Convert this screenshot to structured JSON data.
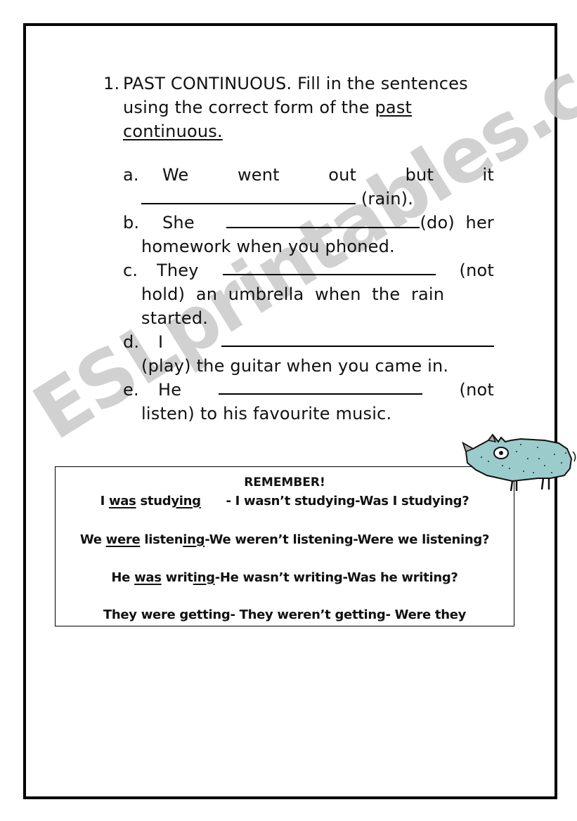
{
  "exercise": {
    "number": "1.",
    "title_plain": "PAST CONTINUOUS. Fill in the sentences using the correct form of the ",
    "title_underlined": "past continuous.",
    "items": [
      {
        "letter": "a.",
        "first": [
          "We",
          "went",
          "out",
          "but",
          "it"
        ],
        "after_blank": "(rain)."
      },
      {
        "letter": "b.",
        "lead": "She",
        "after_blank": "(do)  her",
        "cont": "homework when you phoned."
      },
      {
        "letter": "c.",
        "lead": "They",
        "after_blank": "(not",
        "cont1": "hold)  an  umbrella  when  the  rain",
        "cont2": "started."
      },
      {
        "letter": "d.",
        "lead": "I",
        "cont": "(play) the guitar when you came in."
      },
      {
        "letter": "e.",
        "lead": "He",
        "after_blank": "(not",
        "cont": "listen) to his favourite music."
      }
    ]
  },
  "remember": {
    "title": "REMEMBER!",
    "lines": [
      {
        "parts": [
          {
            "t": "I "
          },
          {
            "t": "was",
            "u": true
          },
          {
            "t": " stud"
          },
          {
            "t": "ying",
            "u": true
          },
          {
            "t": "      - I wasn’t studying-Was I studying?"
          }
        ]
      },
      {
        "parts": [
          {
            "t": "We "
          },
          {
            "t": "were",
            "u": true
          },
          {
            "t": " listen"
          },
          {
            "t": "ing",
            "u": true
          },
          {
            "t": "-We weren’t listening-Were we listening?"
          }
        ]
      },
      {
        "parts": [
          {
            "t": "He "
          },
          {
            "t": "was",
            "u": true
          },
          {
            "t": " writ"
          },
          {
            "t": "ing",
            "u": true
          },
          {
            "t": "-He wasn’t writing-Was he writing?"
          }
        ]
      },
      {
        "parts": [
          {
            "t": "They were getting- They weren’t getting- Were they"
          }
        ]
      }
    ]
  },
  "watermark": "ESLprintables.com",
  "illustration": {
    "icon": "rhino-icon",
    "color": "#9ccbcb"
  }
}
